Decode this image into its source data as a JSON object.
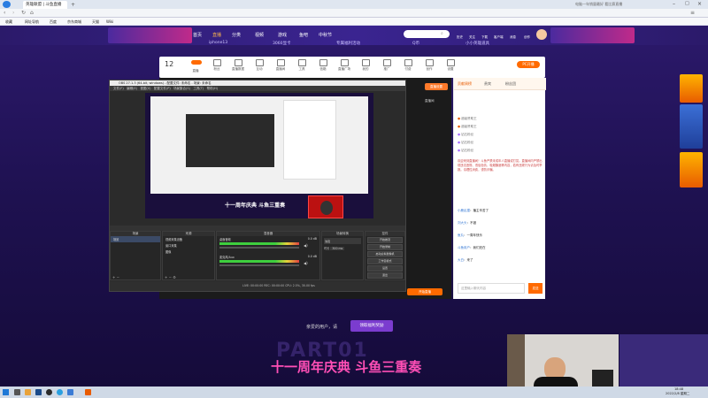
{
  "browser": {
    "tab_title": "英雄联盟 | 斗鱼直播",
    "url": "https://www.douyu.com/topic/zt11?rid=9999",
    "search_placeholder": "电脑一年销量最好 看比赛直播",
    "bookmarks": [
      "收藏",
      "网址导航",
      "百度",
      "京东商城",
      "天猫",
      "Wiki"
    ]
  },
  "nav": {
    "items": [
      "首页",
      "直播",
      "分类",
      "视频",
      "游戏",
      "鱼吧",
      "中秋节"
    ],
    "active": "直播",
    "sub_items": [
      "iphone13",
      "3060显卡",
      "专属福利活动",
      "Q币",
      "小小英雄道具"
    ],
    "search_placeholder": "搜索",
    "right_items": [
      "历史",
      "关注",
      "下载",
      "客户端",
      "消息",
      "创作"
    ]
  },
  "toolbar": {
    "level": "12",
    "items": [
      "直播",
      "粉丝",
      "直播数据",
      "互动",
      "直播间",
      "工具",
      "信箱",
      "直播广场",
      "我的",
      "推广",
      "付费",
      "创作",
      "设置"
    ],
    "promo_label": "PC开播",
    "extra_labels": [
      "直播设置",
      "直播间",
      "开始直播"
    ]
  },
  "obs": {
    "title": "OBS 27.1.3 (64-bit, windows) - 配置文件: 未命名 - 场景: 未命名",
    "menu": [
      "文件(F)",
      "编辑(E)",
      "视图(V)",
      "配置文件(P)",
      "场景集合(S)",
      "工具(T)",
      "帮助(H)"
    ],
    "dock_labels": [
      "场景",
      "来源",
      "混音器",
      "场景转换",
      "控件"
    ],
    "scene_header": "场景",
    "sources": [
      "视频采集设备",
      "窗口采集",
      "图像"
    ],
    "mixer_tracks": [
      {
        "name": "桌面音频",
        "level": "0.0 dB"
      },
      {
        "name": "麦克风/Aux",
        "level": "0.0 dB"
      }
    ],
    "transition_label": "淡出",
    "duration_label": "时长",
    "duration_value": "300 ms",
    "controls": [
      "开始推流",
      "开始录制",
      "启动虚拟摄像机",
      "工作室模式",
      "设置",
      "退出"
    ],
    "status": "LIVE: 00:00:00   REC: 00:00:00   CPU: 2.5%, 30.00 fps"
  },
  "stream_overlay": {
    "banner": "十一周年庆典 斗鱼三重奏"
  },
  "chat": {
    "tabs": [
      "贡献周榜",
      "贵宾",
      "粉丝团"
    ],
    "ranks": [
      "超级赞助王",
      "超级赞助王",
      "钻石粉丝",
      "钻石粉丝",
      "钻石粉丝"
    ],
    "notice": "欢迎来到直播间！斗鱼严禁未成年人直播或打赏。直播间内严禁出现违法违规、低俗色情、吸烟酗酒等内容，若有违规行为请及时举报。请理性消费，谨防诈骗。",
    "messages": [
      {
        "user": "小鹿乱撞",
        "text": "播主辛苦了"
      },
      {
        "user": "刘大头",
        "text": "不错"
      },
      {
        "user": "鱼丸",
        "text": "一周年快乐"
      },
      {
        "user": "斗鱼用户",
        "text": "我们还在"
      },
      {
        "user": "大白",
        "text": "来了"
      }
    ],
    "input_placeholder": "这里输入聊天内容",
    "send_label": "发送"
  },
  "page": {
    "prompt_text": "亲爱的用户，请",
    "prompt_button": "领取福利奖励"
  },
  "event": {
    "title": "十一周年庆典 斗鱼三重奏",
    "part_label": "PART01"
  },
  "taskbar": {
    "time": "18:48",
    "date": "2022/2/8 星期二"
  },
  "colors": {
    "site_nav": "#2b1a6a",
    "accent_orange": "#ff6a00",
    "obs_bg": "#2b2b2b",
    "meter_green": "#3ecf3e"
  }
}
